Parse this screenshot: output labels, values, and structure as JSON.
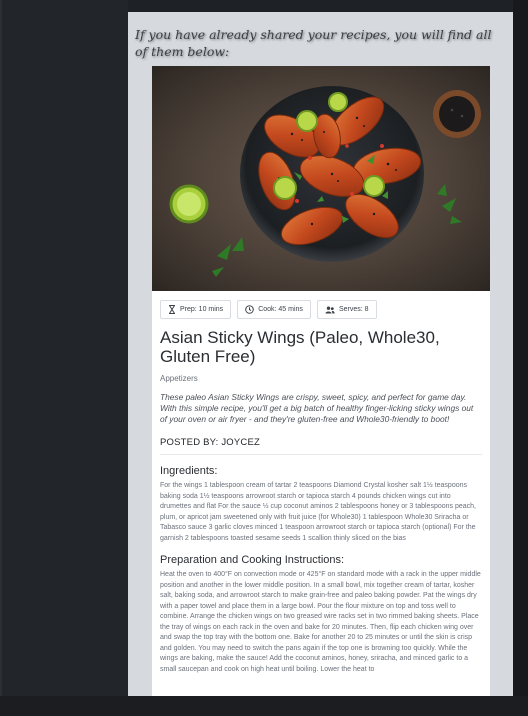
{
  "intro_text": "If you have already shared your recipes, you will find all of them below:",
  "recipe": {
    "photo_icon": "sticky-wings-photo",
    "badges": {
      "prep": {
        "icon": "hourglass-icon",
        "label": "Prep: 10 mins"
      },
      "cook": {
        "icon": "clock-icon",
        "label": "Cook: 45 mins"
      },
      "serves": {
        "icon": "people-icon",
        "label": "Serves: 8"
      }
    },
    "title": "Asian Sticky Wings (Paleo, Whole30, Gluten Free)",
    "category": "Appetizers",
    "description": "These paleo Asian Sticky Wings are crispy, sweet, spicy, and perfect for game day. With this simple recipe, you'll get a big batch of healthy finger-licking sticky wings out of your oven or air fryer - and they're gluten-free and Whole30-friendly to boot!",
    "posted_by": "POSTED BY: JOYCEZ",
    "ingredients_heading": "Ingredients:",
    "ingredients": "For the wings 1 tablespoon cream of tartar 2 teaspoons Diamond Crystal kosher salt 1½ teaspoons baking soda 1½ teaspoons arrowroot starch or tapioca starch 4 pounds chicken wings cut into drumettes and flat For the sauce ½ cup coconut aminos 2 tablespoons honey or 3 tablespoons peach, plum, or apricot jam sweetened only with fruit juice (for Whole30) 1 tablespoon Whole30 Sriracha or Tabasco sauce 3 garlic cloves minced 1 teaspoon arrowroot starch or tapioca starch (optional) For the garnish 2 tablespoons toasted sesame seeds 1 scallion thinly sliced on the bias",
    "instructions_heading": "Preparation and Cooking Instructions:",
    "instructions": "Heat the oven to 400°F on convection mode or 425°F on standard mode with a rack in the upper middle position and another in the lower middle position. In a small bowl, mix together cream of tartar, kosher salt, baking soda, and arrowroot starch to make grain-free and paleo baking powder. Pat the wings dry with a paper towel and place them in a large bowl. Pour the flour mixture on top and toss well to combine. Arrange the chicken wings on two greased wire racks set in two rimmed baking sheets. Place the tray of wings on each rack in the oven and bake for 20 minutes. Then, flip each chicken wing over and swap the top tray with the bottom one. Bake for another 20 to 25 minutes or until the skin is crisp and golden. You may need to switch the pans again if the top one is browning too quickly. While the wings are baking, make the sauce! Add the coconut aminos, honey, sriracha, and minced garlic to a small saucepan and cook on high heat until boiling. Lower the heat to"
  },
  "colors": {
    "page_bg": "#1e2125",
    "content_bg": "#d6d9de",
    "card_bg": "#ffffff"
  }
}
